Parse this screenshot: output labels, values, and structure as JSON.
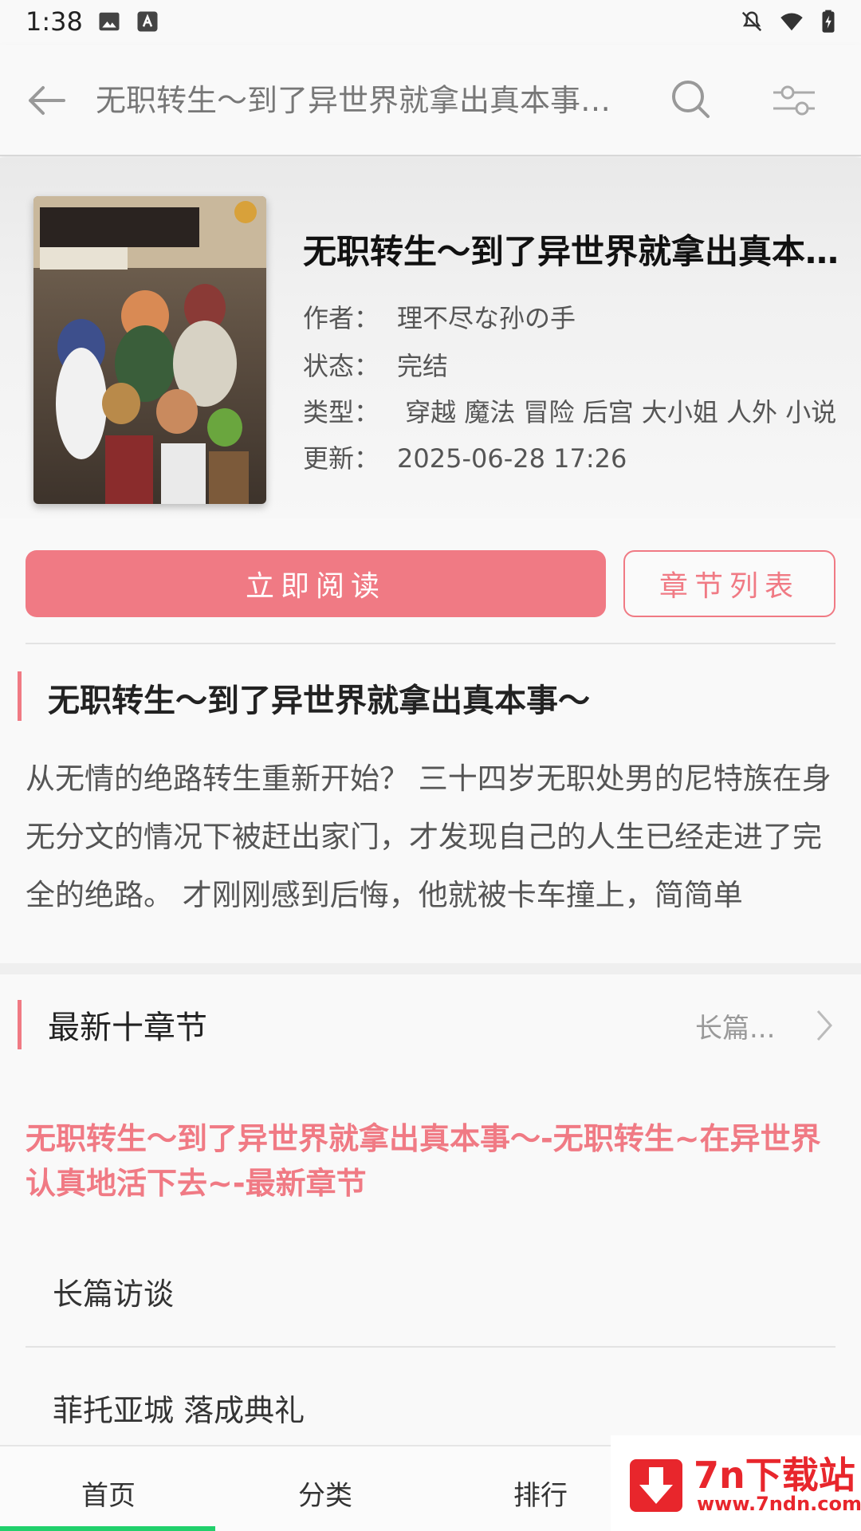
{
  "status_bar": {
    "time": "1:38"
  },
  "app_bar": {
    "title": "无职转生～到了异世界就拿出真本事～-无职转生~在异世界认真地活下去~"
  },
  "book": {
    "title": "无职转生～到了异世界就拿出真本事～",
    "author_label": "作者：",
    "author": "理不尽な孙の手",
    "status_label": "状态：",
    "status": "完结",
    "genre_label": "类型：",
    "genre": " 穿越 魔法 冒险 后宫 大小姐 人外 小说",
    "updated_label": "更新：",
    "updated": "2025-06-28 17:26"
  },
  "actions": {
    "read_now": "立即阅读",
    "chapter_list": "章节列表"
  },
  "intro": {
    "title": "无职转生～到了异世界就拿出真本事～",
    "summary": "从无情的绝路转生重新开始？ 三十四岁无职处男的尼特族在身无分文的情况下被赶出家门，才发现自己的人生已经走进了完全的绝路。 才刚刚感到后悔，他就被卡车撞上，简简单"
  },
  "latest": {
    "title": "最新十章节",
    "more_label": "长篇...",
    "heading": "无职转生～到了异世界就拿出真本事～-无职转生~在异世界认真地活下去~-最新章节",
    "chapters": [
      "长篇访谈",
      "菲托亚城 落成典礼"
    ]
  },
  "bottom_nav": {
    "items": [
      "首页",
      "分类",
      "排行"
    ]
  },
  "watermark": {
    "name": "7n下载站",
    "url": "www.7ndn.com"
  },
  "colors": {
    "accent": "#f07a84",
    "nav_indicator": "#21d06b",
    "watermark": "#e8262c"
  }
}
